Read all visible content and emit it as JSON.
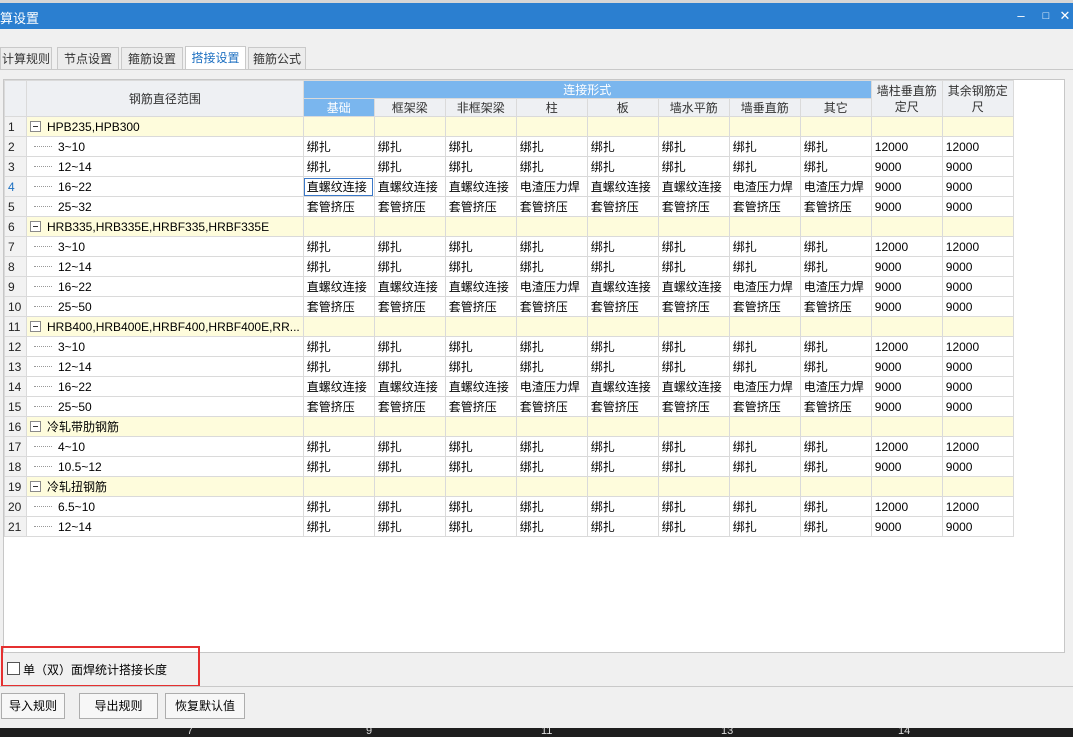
{
  "window": {
    "title": "算设置",
    "min_icon": "minimize-icon",
    "max_icon": "maximize-icon",
    "close_icon": "close-icon"
  },
  "tabs": [
    {
      "label": "计算规则"
    },
    {
      "label": "节点设置"
    },
    {
      "label": "箍筋设置"
    },
    {
      "label": "搭接设置",
      "active": true
    },
    {
      "label": "箍筋公式"
    }
  ],
  "table": {
    "header": {
      "range": "钢筋直径范围",
      "group": "连接形式",
      "columns": [
        "基础",
        "框架梁",
        "非框架梁",
        "柱",
        "板",
        "墙水平筋",
        "墙垂直筋",
        "其它"
      ],
      "wall_vertical": "墙柱垂直筋定尺",
      "other_bar": "其余钢筋定尺"
    },
    "rows": [
      {
        "n": "1",
        "name": "HPB235,HPB300",
        "group": true
      },
      {
        "n": "2",
        "name": "3~10",
        "cells": [
          "绑扎",
          "绑扎",
          "绑扎",
          "绑扎",
          "绑扎",
          "绑扎",
          "绑扎",
          "绑扎",
          "12000",
          "12000"
        ]
      },
      {
        "n": "3",
        "name": "12~14",
        "cells": [
          "绑扎",
          "绑扎",
          "绑扎",
          "绑扎",
          "绑扎",
          "绑扎",
          "绑扎",
          "绑扎",
          "9000",
          "9000"
        ]
      },
      {
        "n": "4",
        "name": "16~22",
        "cells": [
          "直螺纹连接",
          "直螺纹连接",
          "直螺纹连接",
          "电渣压力焊",
          "直螺纹连接",
          "直螺纹连接",
          "电渣压力焊",
          "电渣压力焊",
          "9000",
          "9000"
        ],
        "current": true
      },
      {
        "n": "5",
        "name": "25~32",
        "cells": [
          "套管挤压",
          "套管挤压",
          "套管挤压",
          "套管挤压",
          "套管挤压",
          "套管挤压",
          "套管挤压",
          "套管挤压",
          "9000",
          "9000"
        ]
      },
      {
        "n": "6",
        "name": "HRB335,HRB335E,HRBF335,HRBF335E",
        "group": true
      },
      {
        "n": "7",
        "name": "3~10",
        "cells": [
          "绑扎",
          "绑扎",
          "绑扎",
          "绑扎",
          "绑扎",
          "绑扎",
          "绑扎",
          "绑扎",
          "12000",
          "12000"
        ]
      },
      {
        "n": "8",
        "name": "12~14",
        "cells": [
          "绑扎",
          "绑扎",
          "绑扎",
          "绑扎",
          "绑扎",
          "绑扎",
          "绑扎",
          "绑扎",
          "9000",
          "9000"
        ]
      },
      {
        "n": "9",
        "name": "16~22",
        "cells": [
          "直螺纹连接",
          "直螺纹连接",
          "直螺纹连接",
          "电渣压力焊",
          "直螺纹连接",
          "直螺纹连接",
          "电渣压力焊",
          "电渣压力焊",
          "9000",
          "9000"
        ]
      },
      {
        "n": "10",
        "name": "25~50",
        "cells": [
          "套管挤压",
          "套管挤压",
          "套管挤压",
          "套管挤压",
          "套管挤压",
          "套管挤压",
          "套管挤压",
          "套管挤压",
          "9000",
          "9000"
        ]
      },
      {
        "n": "11",
        "name": "HRB400,HRB400E,HRBF400,HRBF400E,RR...",
        "group": true
      },
      {
        "n": "12",
        "name": "3~10",
        "cells": [
          "绑扎",
          "绑扎",
          "绑扎",
          "绑扎",
          "绑扎",
          "绑扎",
          "绑扎",
          "绑扎",
          "12000",
          "12000"
        ]
      },
      {
        "n": "13",
        "name": "12~14",
        "cells": [
          "绑扎",
          "绑扎",
          "绑扎",
          "绑扎",
          "绑扎",
          "绑扎",
          "绑扎",
          "绑扎",
          "9000",
          "9000"
        ]
      },
      {
        "n": "14",
        "name": "16~22",
        "cells": [
          "直螺纹连接",
          "直螺纹连接",
          "直螺纹连接",
          "电渣压力焊",
          "直螺纹连接",
          "直螺纹连接",
          "电渣压力焊",
          "电渣压力焊",
          "9000",
          "9000"
        ]
      },
      {
        "n": "15",
        "name": "25~50",
        "cells": [
          "套管挤压",
          "套管挤压",
          "套管挤压",
          "套管挤压",
          "套管挤压",
          "套管挤压",
          "套管挤压",
          "套管挤压",
          "9000",
          "9000"
        ]
      },
      {
        "n": "16",
        "name": "冷轧带肋钢筋",
        "group": true
      },
      {
        "n": "17",
        "name": "4~10",
        "cells": [
          "绑扎",
          "绑扎",
          "绑扎",
          "绑扎",
          "绑扎",
          "绑扎",
          "绑扎",
          "绑扎",
          "12000",
          "12000"
        ]
      },
      {
        "n": "18",
        "name": "10.5~12",
        "cells": [
          "绑扎",
          "绑扎",
          "绑扎",
          "绑扎",
          "绑扎",
          "绑扎",
          "绑扎",
          "绑扎",
          "9000",
          "9000"
        ]
      },
      {
        "n": "19",
        "name": "冷轧扭钢筋",
        "group": true
      },
      {
        "n": "20",
        "name": "6.5~10",
        "cells": [
          "绑扎",
          "绑扎",
          "绑扎",
          "绑扎",
          "绑扎",
          "绑扎",
          "绑扎",
          "绑扎",
          "12000",
          "12000"
        ]
      },
      {
        "n": "21",
        "name": "12~14",
        "cells": [
          "绑扎",
          "绑扎",
          "绑扎",
          "绑扎",
          "绑扎",
          "绑扎",
          "绑扎",
          "绑扎",
          "9000",
          "9000"
        ]
      }
    ]
  },
  "option": {
    "label": "单（双）面焊统计搭接长度",
    "checked": false
  },
  "buttons": {
    "import": "导入规则",
    "export": "导出规则",
    "restore": "恢复默认值"
  },
  "footer_ticks": [
    "7",
    "9",
    "11",
    "13",
    "14"
  ]
}
